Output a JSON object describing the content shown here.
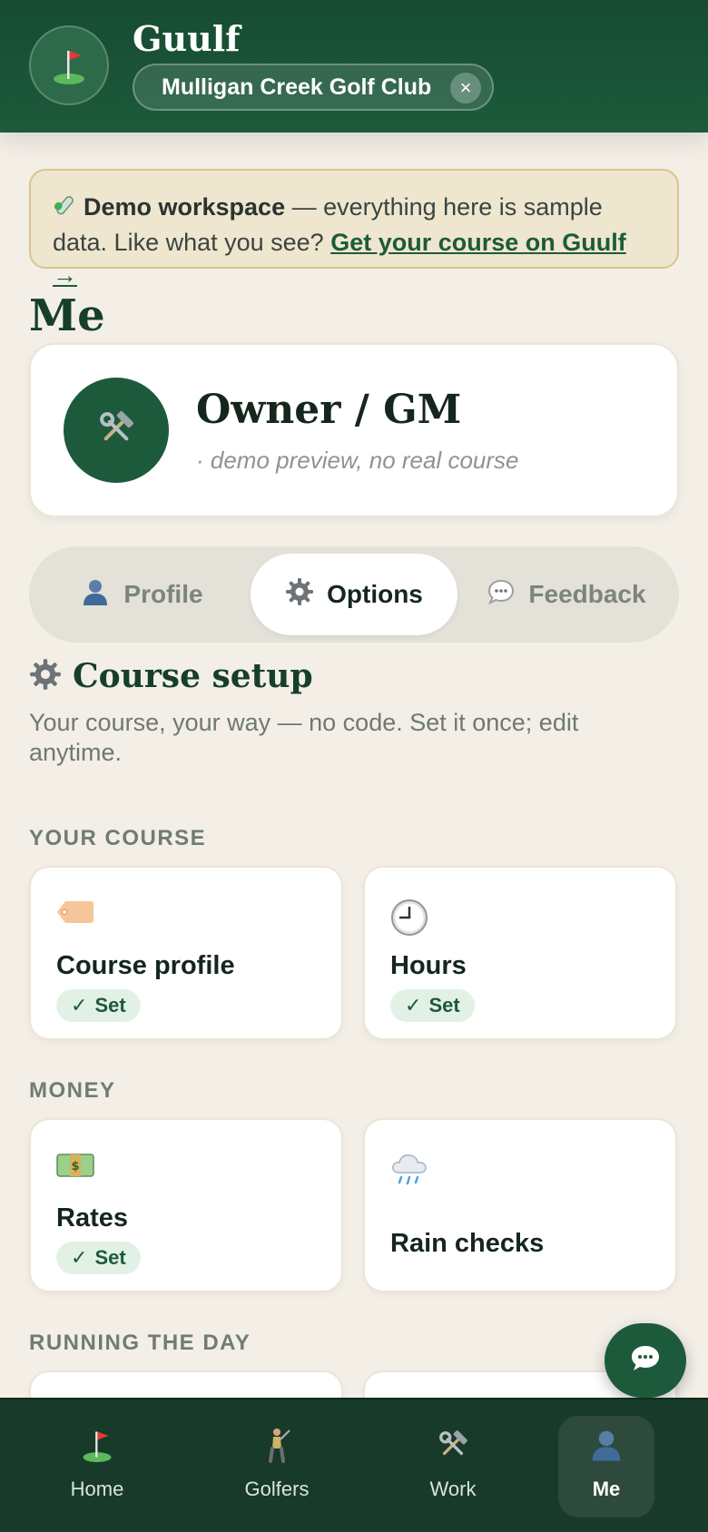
{
  "header": {
    "app_name": "Guulf",
    "course_name": "Mulligan Creek Golf Club",
    "close_glyph": "×"
  },
  "banner": {
    "icon": "test-tube-icon",
    "bold": "Demo workspace",
    "text": " — everything here is sample data. Like what you see? ",
    "cta": "Get your course on Guulf →"
  },
  "page_title": "Me",
  "owner": {
    "name": "Owner / GM",
    "subtitle": "· demo preview, no real course",
    "icon": "hammer-wrench-icon"
  },
  "tabs": [
    {
      "label": "Profile",
      "icon": "person-icon",
      "active": false
    },
    {
      "label": "Options",
      "icon": "gear-icon",
      "active": true
    },
    {
      "label": "Feedback",
      "icon": "speech-bubble-icon",
      "active": false
    }
  ],
  "section": {
    "title": "Course setup",
    "description": "Your course, your way — no code. Set it once; edit anytime."
  },
  "groups": [
    {
      "label": "YOUR COURSE",
      "cards": [
        {
          "name": "Course profile",
          "icon": "tag-icon",
          "badge": "Set"
        },
        {
          "name": "Hours",
          "icon": "clock-icon",
          "badge": "Set"
        }
      ]
    },
    {
      "label": "MONEY",
      "cards": [
        {
          "name": "Rates",
          "icon": "money-icon",
          "badge": "Set"
        },
        {
          "name": "Rain checks",
          "icon": "rain-cloud-icon",
          "badge": ""
        }
      ]
    },
    {
      "label": "RUNNING THE DAY",
      "cards": []
    }
  ],
  "check_glyph": "✓",
  "nav": [
    {
      "label": "Home",
      "icon": "golf-flag-icon",
      "active": false
    },
    {
      "label": "Golfers",
      "icon": "golfer-icon",
      "active": false
    },
    {
      "label": "Work",
      "icon": "hammer-wrench-icon",
      "active": false
    },
    {
      "label": "Me",
      "icon": "person-icon",
      "active": true
    }
  ],
  "colors": {
    "brand_green": "#1d5a3b",
    "header_green": "#164b32",
    "background": "#f3efe7",
    "banner_bg": "#efe6cf",
    "badge_bg": "#e2f1e6"
  }
}
